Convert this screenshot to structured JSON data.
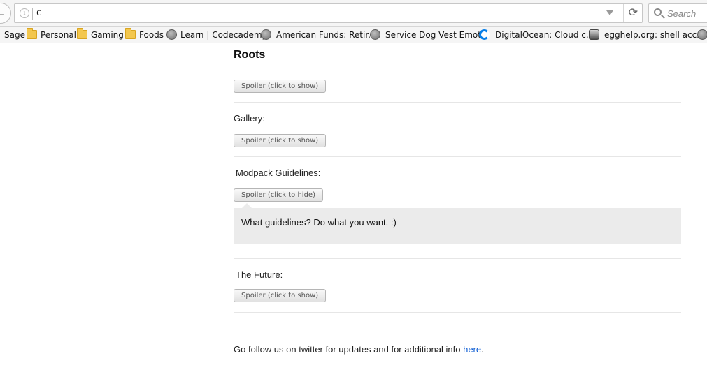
{
  "browser": {
    "url_text": "c",
    "search_placeholder": "Search",
    "bookmarks": [
      {
        "label": "Sage",
        "icon": "none"
      },
      {
        "label": "Personal",
        "icon": "folder-icon"
      },
      {
        "label": "Gaming",
        "icon": "folder-icon"
      },
      {
        "label": "Foods",
        "icon": "folder-icon"
      },
      {
        "label": "Learn | Codecademy",
        "icon": "globe-icon"
      },
      {
        "label": "American Funds: Retir...",
        "icon": "globe-icon"
      },
      {
        "label": "Service Dog Vest Emot...",
        "icon": "globe-icon"
      },
      {
        "label": "DigitalOcean: Cloud c...",
        "icon": "digitalocean-icon"
      },
      {
        "label": "egghelp.org: shell acc...",
        "icon": "egghelp-icon"
      },
      {
        "label": "",
        "icon": "globe-icon"
      }
    ]
  },
  "page": {
    "title": "Roots",
    "sections": [
      {
        "label": "",
        "button": "Spoiler (click to show)"
      },
      {
        "label": "Gallery:",
        "button": "Spoiler (click to show)"
      },
      {
        "label": "Modpack Guidelines:",
        "button": "Spoiler (click to hide)",
        "revealed_text": "What guidelines? Do what you want. :)"
      },
      {
        "label": "The Future:",
        "button": "Spoiler (click to show)"
      }
    ],
    "footer": {
      "text": "Go follow us on twitter for updates and for additional info ",
      "link": "here",
      "end": "."
    }
  }
}
